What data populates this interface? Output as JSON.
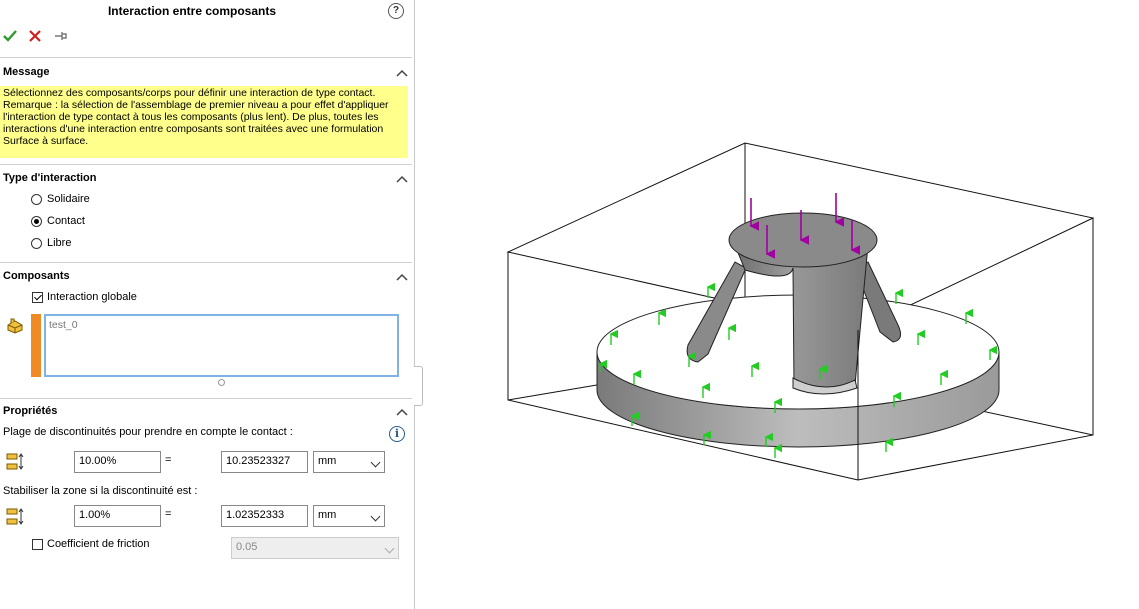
{
  "panel": {
    "title": "Interaction entre composants",
    "help_icon": "?",
    "toolbar": {
      "ok_icon": "check-icon",
      "cancel_icon": "x-icon",
      "pin_icon": "pushpin-icon"
    }
  },
  "message": {
    "header": "Message",
    "text": "Sélectionnez des composants/corps pour définir une interaction de type contact. Remarque : la sélection de l'assemblage de premier niveau a pour effet d'appliquer l'interaction de type contact à tous les composants (plus lent). De plus, toutes les interactions d'une interaction entre composants sont traitées avec une formulation Surface à surface.",
    "bg_color": "#ffff8c"
  },
  "interaction_type": {
    "header": "Type d'interaction",
    "options": [
      {
        "label": "Solidaire",
        "selected": false
      },
      {
        "label": "Contact",
        "selected": true
      },
      {
        "label": "Libre",
        "selected": false
      }
    ]
  },
  "components": {
    "header": "Composants",
    "global_label": "Interaction globale",
    "global_checked": true,
    "items": [
      "test_0"
    ]
  },
  "properties": {
    "header": "Propriétés",
    "gap_label": "Plage de discontinuités pour prendre en compte le contact :",
    "gap_percent": "10.00%",
    "gap_value": "10.23523327",
    "gap_unit": "mm",
    "stab_label": "Stabiliser la zone si la discontinuité est :",
    "stab_percent": "1.00%",
    "stab_value": "1.02352333",
    "stab_unit": "mm",
    "equals": "=",
    "friction_label": "Coefficient de friction",
    "friction_checked": false,
    "friction_value": "0.05",
    "info_icon": "i"
  },
  "viewport": {
    "load_arrow_color": "#a000a0",
    "fixture_arrow_color": "#22cc22",
    "part_color": "#8f8f8f"
  }
}
